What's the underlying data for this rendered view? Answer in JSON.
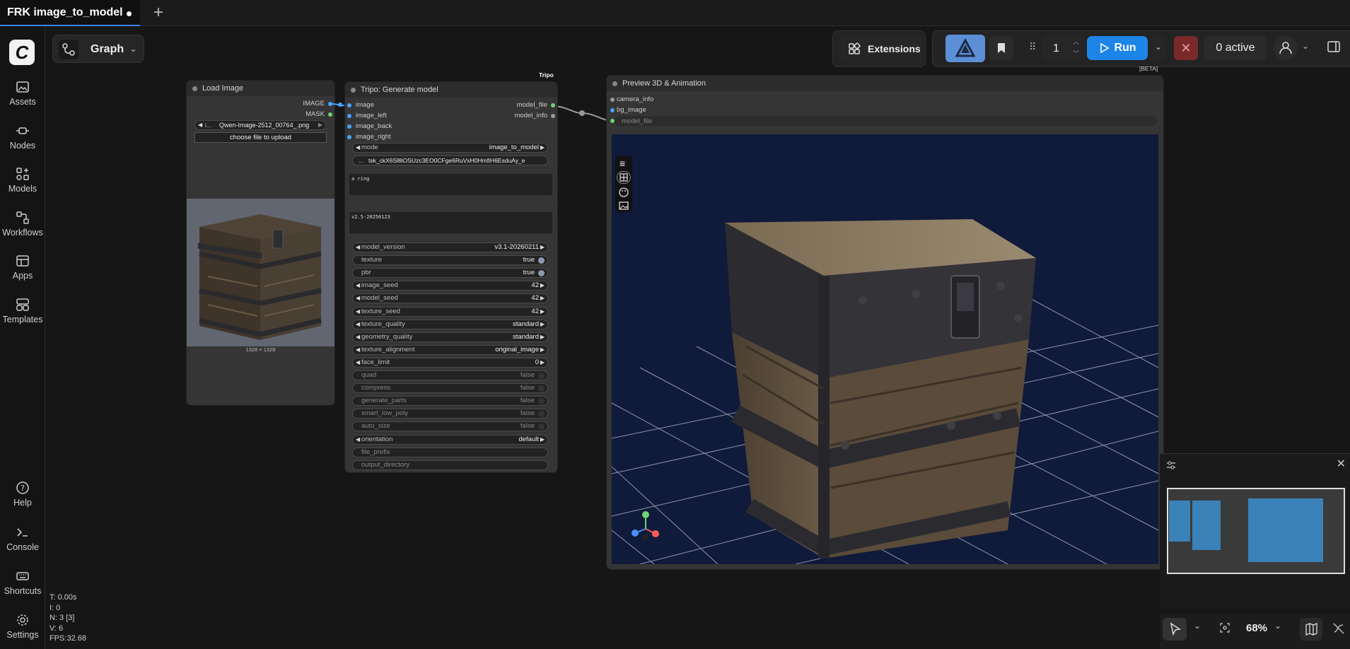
{
  "tab": {
    "title": "FRK image_to_model",
    "plus": "+"
  },
  "sidebar": {
    "items": [
      {
        "label": "Assets",
        "icon": "image-icon"
      },
      {
        "label": "Nodes",
        "icon": "node-icon"
      },
      {
        "label": "Models",
        "icon": "models-icon"
      },
      {
        "label": "Workflows",
        "icon": "workflow-icon"
      },
      {
        "label": "Apps",
        "icon": "apps-icon"
      },
      {
        "label": "Templates",
        "icon": "templates-icon"
      }
    ],
    "bottom": [
      {
        "label": "Help",
        "icon": "help-icon"
      },
      {
        "label": "Console",
        "icon": "console-icon"
      },
      {
        "label": "Shortcuts",
        "icon": "keyboard-icon"
      },
      {
        "label": "Settings",
        "icon": "gear-icon"
      }
    ]
  },
  "graph": {
    "label": "Graph"
  },
  "toolbar": {
    "extensions": "Extensions",
    "queue_count": "1",
    "run": "Run",
    "active": "0 active"
  },
  "load_image": {
    "title": "Load Image",
    "out_image": "IMAGE",
    "out_mask": "MASK",
    "file_prefix": "i...",
    "file": "Qwen-Image-2512_00764_.png",
    "upload": "choose file to upload",
    "dims": "1328 × 1328"
  },
  "tripo": {
    "badge": "Tripo",
    "title": "Tripo: Generate model",
    "inputs": [
      "image",
      "image_left",
      "image_back",
      "image_right"
    ],
    "outputs": [
      "model_file",
      "model_info"
    ],
    "mode_label": "mode",
    "mode_value": "image_to_model",
    "key_value": "tsk_ckX6S8liOSUzc3EO0CFge6RuVxH0HmfiH6EsduAy_e",
    "key_prefix": "...",
    "prompt": "a ring",
    "version_text": "v2.5-20250123",
    "widgets": [
      {
        "label": "model_version",
        "value": "v3.1-20260211",
        "kind": "combo"
      },
      {
        "label": "texture",
        "value": "true",
        "kind": "toggle"
      },
      {
        "label": "pbr",
        "value": "true",
        "kind": "toggle"
      },
      {
        "label": "image_seed",
        "value": "42",
        "kind": "combo"
      },
      {
        "label": "model_seed",
        "value": "42",
        "kind": "combo"
      },
      {
        "label": "texture_seed",
        "value": "42",
        "kind": "combo"
      },
      {
        "label": "texture_quality",
        "value": "standard",
        "kind": "combo"
      },
      {
        "label": "geometry_quality",
        "value": "standard",
        "kind": "combo"
      },
      {
        "label": "texture_alignment",
        "value": "original_image",
        "kind": "combo"
      },
      {
        "label": "face_limit",
        "value": "0",
        "kind": "combo"
      },
      {
        "label": "quad",
        "value": "false",
        "kind": "off"
      },
      {
        "label": "compress",
        "value": "false",
        "kind": "off"
      },
      {
        "label": "generate_parts",
        "value": "false",
        "kind": "off"
      },
      {
        "label": "smart_low_poly",
        "value": "false",
        "kind": "off"
      },
      {
        "label": "auto_size",
        "value": "false",
        "kind": "off"
      },
      {
        "label": "orientation",
        "value": "default",
        "kind": "combo"
      },
      {
        "label": "file_prefix",
        "value": "",
        "kind": "text"
      },
      {
        "label": "output_directory",
        "value": "",
        "kind": "text"
      }
    ]
  },
  "preview": {
    "badge": "[BETA]",
    "title": "Preview 3D & Animation",
    "inputs": [
      "camera_info",
      "bg_image",
      "model_file"
    ]
  },
  "stats": {
    "t": "T: 0.00s",
    "i": "I: 0",
    "n": "N: 3 [3]",
    "v": "V: 6",
    "fps": "FPS:32.68"
  },
  "zoom": "68%",
  "colors": {
    "accent": "#1d85e8",
    "viewport_bg": "#101a3a",
    "minimap_node": "#3a82b8"
  }
}
